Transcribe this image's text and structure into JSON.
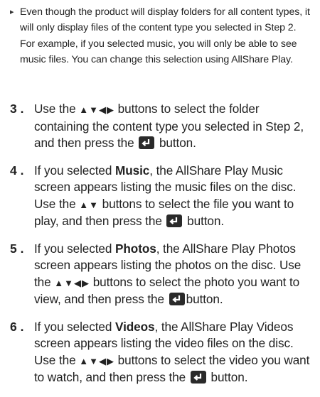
{
  "note": {
    "bullet": "▸",
    "text": "Even though the product will display folders for all content types, it will only display files of the content type you selected in Step 2. For example, if you selected music, you will only be able to see music files. You can change this selection using AllShare Play."
  },
  "icons": {
    "arrows_all": "▲▼◀▶",
    "arrows_updown": "▲▼",
    "enter": "enter-button-icon"
  },
  "steps": [
    {
      "num": "3 .",
      "pre": "Use the",
      "arrows": "▲▼◀▶",
      "mid": "buttons to select the folder containing the content type you selected in Step 2, and then press the",
      "post": "button."
    },
    {
      "num": "4 .",
      "lead": "If you selected",
      "keyword": "Music",
      "text": ", the AllShare Play Music screen appears listing the music files on the disc. Use the",
      "arrows": "▲▼",
      "mid": "buttons to select the file you want to play, and then press the",
      "post": "button."
    },
    {
      "num": "5 .",
      "lead": "If you selected",
      "keyword": "Photos",
      "text": ", the AllShare Play Photos screen appears listing the photos on the disc. Use the",
      "arrows": "▲▼◀▶",
      "mid": "buttons to select the photo you want to view, and then press the",
      "post": "button."
    },
    {
      "num": "6 .",
      "lead": "If you selected",
      "keyword": "Videos",
      "text": ", the AllShare Play Videos screen appears listing the video files on the disc. Use the",
      "arrows": "▲▼◀▶",
      "mid": "buttons to select the video you want to watch, and then press the",
      "post": "button."
    }
  ]
}
